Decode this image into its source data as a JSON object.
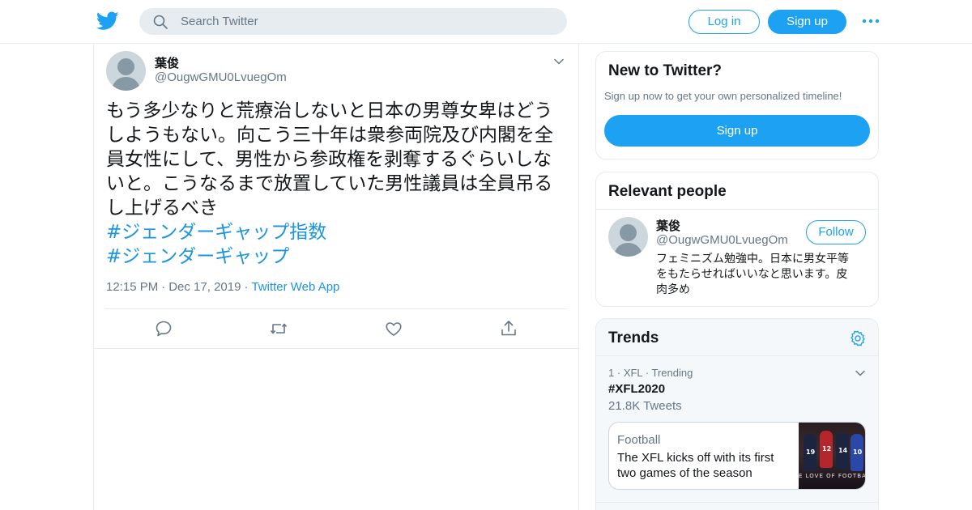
{
  "topbar": {
    "search_placeholder": "Search Twitter",
    "login_label": "Log in",
    "signup_label": "Sign up"
  },
  "tweet": {
    "author_name": "葉俊",
    "author_handle": "@OugwGMU0LvuegOm",
    "text_lines": [
      "もう多少なりと荒療治しないと日本の男尊女卑はどう",
      "しようもない。向こう三十年は衆参両院及び内閣を全",
      "員女性にして、男性から参政権を剥奪するぐらいしな",
      "いと。こうなるまで放置していた男性議員は全員吊る",
      "し上げるべき"
    ],
    "hashtags": [
      "#ジェンダーギャップ指数",
      "#ジェンダーギャップ"
    ],
    "time": "12:15 PM",
    "date": "Dec 17, 2019",
    "source": "Twitter Web App"
  },
  "new_to_twitter": {
    "title": "New to Twitter?",
    "subtitle": "Sign up now to get your own personalized timeline!",
    "button_label": "Sign up"
  },
  "relevant_people": {
    "title": "Relevant people",
    "person": {
      "name": "葉俊",
      "handle": "@OugwGMU0LvuegOm",
      "follow_label": "Follow",
      "bio_lines": [
        "フェミニズム勉強中。日本に男女平等",
        "をもたらせればいいなと思います。皮",
        "肉多め"
      ]
    }
  },
  "trends": {
    "title": "Trends",
    "item": {
      "rank": "1",
      "category": "XFL",
      "status": "Trending",
      "hashtag": "#XFL2020",
      "count": "21.8K Tweets",
      "news_category": "Football",
      "news_headline": "The XFL kicks off with its first two games of the season",
      "image_caption": "E LOVE OF FOOTBALL",
      "player_numbers": [
        "19",
        "12",
        "14",
        "10"
      ]
    }
  },
  "colors": {
    "brand_blue": "#1da1f2",
    "link_blue": "#1b95e0",
    "secondary_text": "#657786",
    "border": "#e6ecf0"
  }
}
